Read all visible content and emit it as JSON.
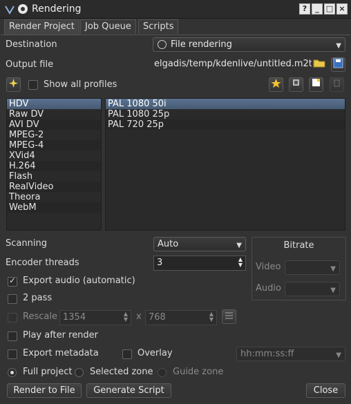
{
  "window": {
    "title": "Rendering",
    "buttons": {
      "help": "?",
      "minimize": "_",
      "maximize": "□",
      "close": "×"
    }
  },
  "tabs": [
    {
      "label": "Render Project",
      "active": true
    },
    {
      "label": "Job Queue",
      "active": false
    },
    {
      "label": "Scripts",
      "active": false
    }
  ],
  "destination": {
    "label": "Destination",
    "value": "File rendering"
  },
  "output": {
    "label": "Output file",
    "value": "elgadis/temp/kdenlive/untitled.m2t"
  },
  "profiles": {
    "show_all_label": "Show all profiles",
    "show_all_checked": false
  },
  "formats": [
    "HDV",
    "Raw DV",
    "AVI DV",
    "MPEG-2",
    "MPEG-4",
    "XVid4",
    "H.264",
    "Flash",
    "RealVideo",
    "Theora",
    "WebM"
  ],
  "formats_selected": 0,
  "profile_list": [
    "PAL 1080 50i",
    "PAL 1080 25p",
    "PAL 720 25p"
  ],
  "profile_selected": 0,
  "scanning": {
    "label": "Scanning",
    "value": "Auto"
  },
  "encoder": {
    "label": "Encoder threads",
    "value": "3"
  },
  "bitrate": {
    "title": "Bitrate",
    "video_label": "Video",
    "audio_label": "Audio"
  },
  "export_audio": {
    "label": "Export audio (automatic)",
    "checked": true
  },
  "two_pass": {
    "label": "2 pass",
    "checked": false
  },
  "rescale": {
    "label": "Rescale",
    "width": "1354",
    "x": "x",
    "height": "768"
  },
  "play_after": {
    "label": "Play after render",
    "checked": false
  },
  "export_metadata": {
    "label": "Export metadata",
    "checked": false
  },
  "overlay": {
    "label": "Overlay",
    "checked": false,
    "value": "hh:mm:ss:ff"
  },
  "zones": {
    "full": "Full project",
    "selected": "Selected zone",
    "guide": "Guide zone"
  },
  "actions": {
    "render": "Render to File",
    "script": "Generate Script",
    "close": "Close"
  },
  "icons": [
    "kdenlive-logo-icon",
    "pin-icon",
    "folder-icon",
    "save-icon",
    "wand-icon",
    "star-icon",
    "edit-icon",
    "new-profile-icon",
    "delete-icon",
    "link-icon"
  ]
}
